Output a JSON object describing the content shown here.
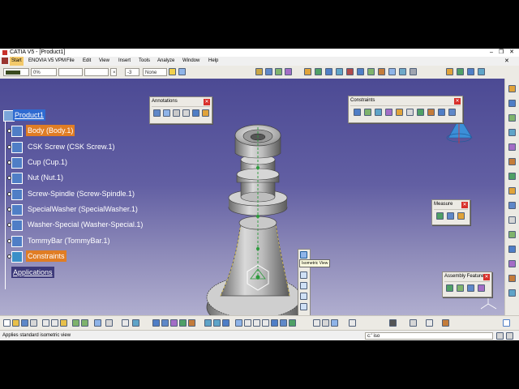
{
  "window": {
    "title": "CATIA V5 - [Product1]",
    "controls": [
      "–",
      "❐",
      "✕"
    ]
  },
  "menu": {
    "items": [
      "Start",
      "ENOVIA V5 VPM",
      "File",
      "Edit",
      "View",
      "Insert",
      "Tools",
      "Analyze",
      "Window",
      "Help"
    ]
  },
  "toolbar": {
    "line_weight": "0%",
    "layer": "None",
    "spinner_value": "-3"
  },
  "tree": {
    "root": "Product1",
    "items": [
      {
        "label": "Body (Body.1)",
        "selected": true
      },
      {
        "label": "CSK Screw (CSK Screw.1)",
        "selected": false
      },
      {
        "label": "Cup (Cup.1)",
        "selected": false
      },
      {
        "label": "Nut (Nut.1)",
        "selected": false
      },
      {
        "label": "Screw-Spindle (Screw-Spindle.1)",
        "selected": false
      },
      {
        "label": "SpecialWasher (SpecialWasher.1)",
        "selected": false
      },
      {
        "label": "Washer-Special (Washer-Special.1)",
        "selected": false
      },
      {
        "label": "TommyBar (TommyBar.1)",
        "selected": false
      },
      {
        "label": "Constraints",
        "selected": true
      }
    ],
    "applications": "Applications"
  },
  "panels": {
    "annotations": "Annotations",
    "constraints": "Constraints",
    "measure": "Measure",
    "assembly_features": "Assembly Features"
  },
  "tooltip": "Isometric View",
  "status": {
    "message": "Applies standard isometric view",
    "command_prefix": "c:' iso"
  },
  "colors": {
    "viewport_top": "#4c4a94",
    "viewport_bottom": "#b0aecf",
    "selection": "#e07d24",
    "root_highlight": "#2f6bd1"
  }
}
